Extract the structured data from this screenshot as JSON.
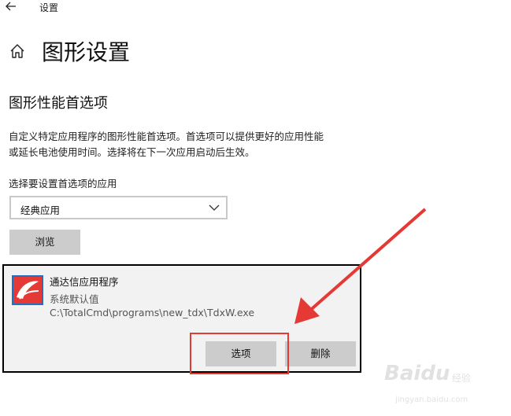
{
  "window": {
    "title": "设置",
    "back_icon": "arrow-left-icon"
  },
  "header": {
    "home_icon": "home-icon",
    "title": "图形设置"
  },
  "section": {
    "title": "图形性能首选项",
    "description_line1": "自定义特定应用程序的图形性能首选项。首选项可以提供更好的应用性能",
    "description_line2": "或延长电池使用时间。选择将在下一次应用启动后生效。"
  },
  "app_picker": {
    "label": "选择要设置首选项的应用",
    "selected": "经典应用",
    "browse_label": "浏览"
  },
  "app_entry": {
    "name": "通达信应用程序",
    "status": "系统默认值",
    "path": "C:\\TotalCmd\\programs\\new_tdx\\TdxW.exe",
    "options_label": "选项",
    "delete_label": "删除"
  },
  "annotation": {
    "color": "#e53935"
  },
  "watermark": {
    "brand": "Baidu",
    "brand_cn": "经验",
    "url": "jingyan.baidu.com"
  }
}
